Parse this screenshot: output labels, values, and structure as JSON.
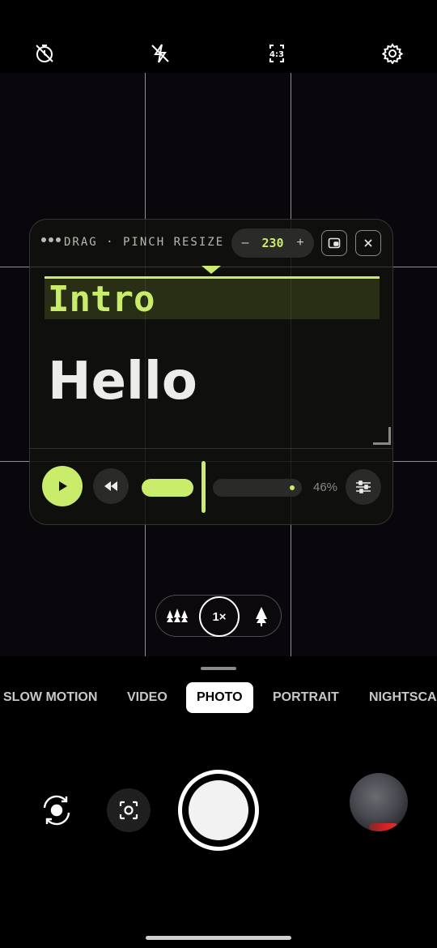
{
  "top_bar": {
    "icons": [
      "timer-off-icon",
      "flash-off-icon",
      "aspect-ratio-icon",
      "settings-icon"
    ],
    "aspect_label": "4:3"
  },
  "prompter": {
    "title": "DRAG · PINCH RESIZE",
    "stepper": {
      "minus": "–",
      "value": "230",
      "plus": "+"
    },
    "lines": [
      "Intro",
      "Hello"
    ],
    "speed_percent_label": "46%",
    "speed_percent": 46,
    "accent_color": "#c9ec6a"
  },
  "zoom": {
    "label": "1×",
    "icons": [
      "wide-lens-icon",
      "tele-lens-icon"
    ]
  },
  "modes": {
    "items": [
      "SLOW MOTION",
      "VIDEO",
      "PHOTO",
      "PORTRAIT",
      "NIGHTSCA"
    ],
    "active": "PHOTO"
  },
  "bottom": {
    "icons": [
      "switch-camera-icon",
      "lens-scan-icon",
      "shutter-button",
      "gallery-thumbnail"
    ]
  }
}
